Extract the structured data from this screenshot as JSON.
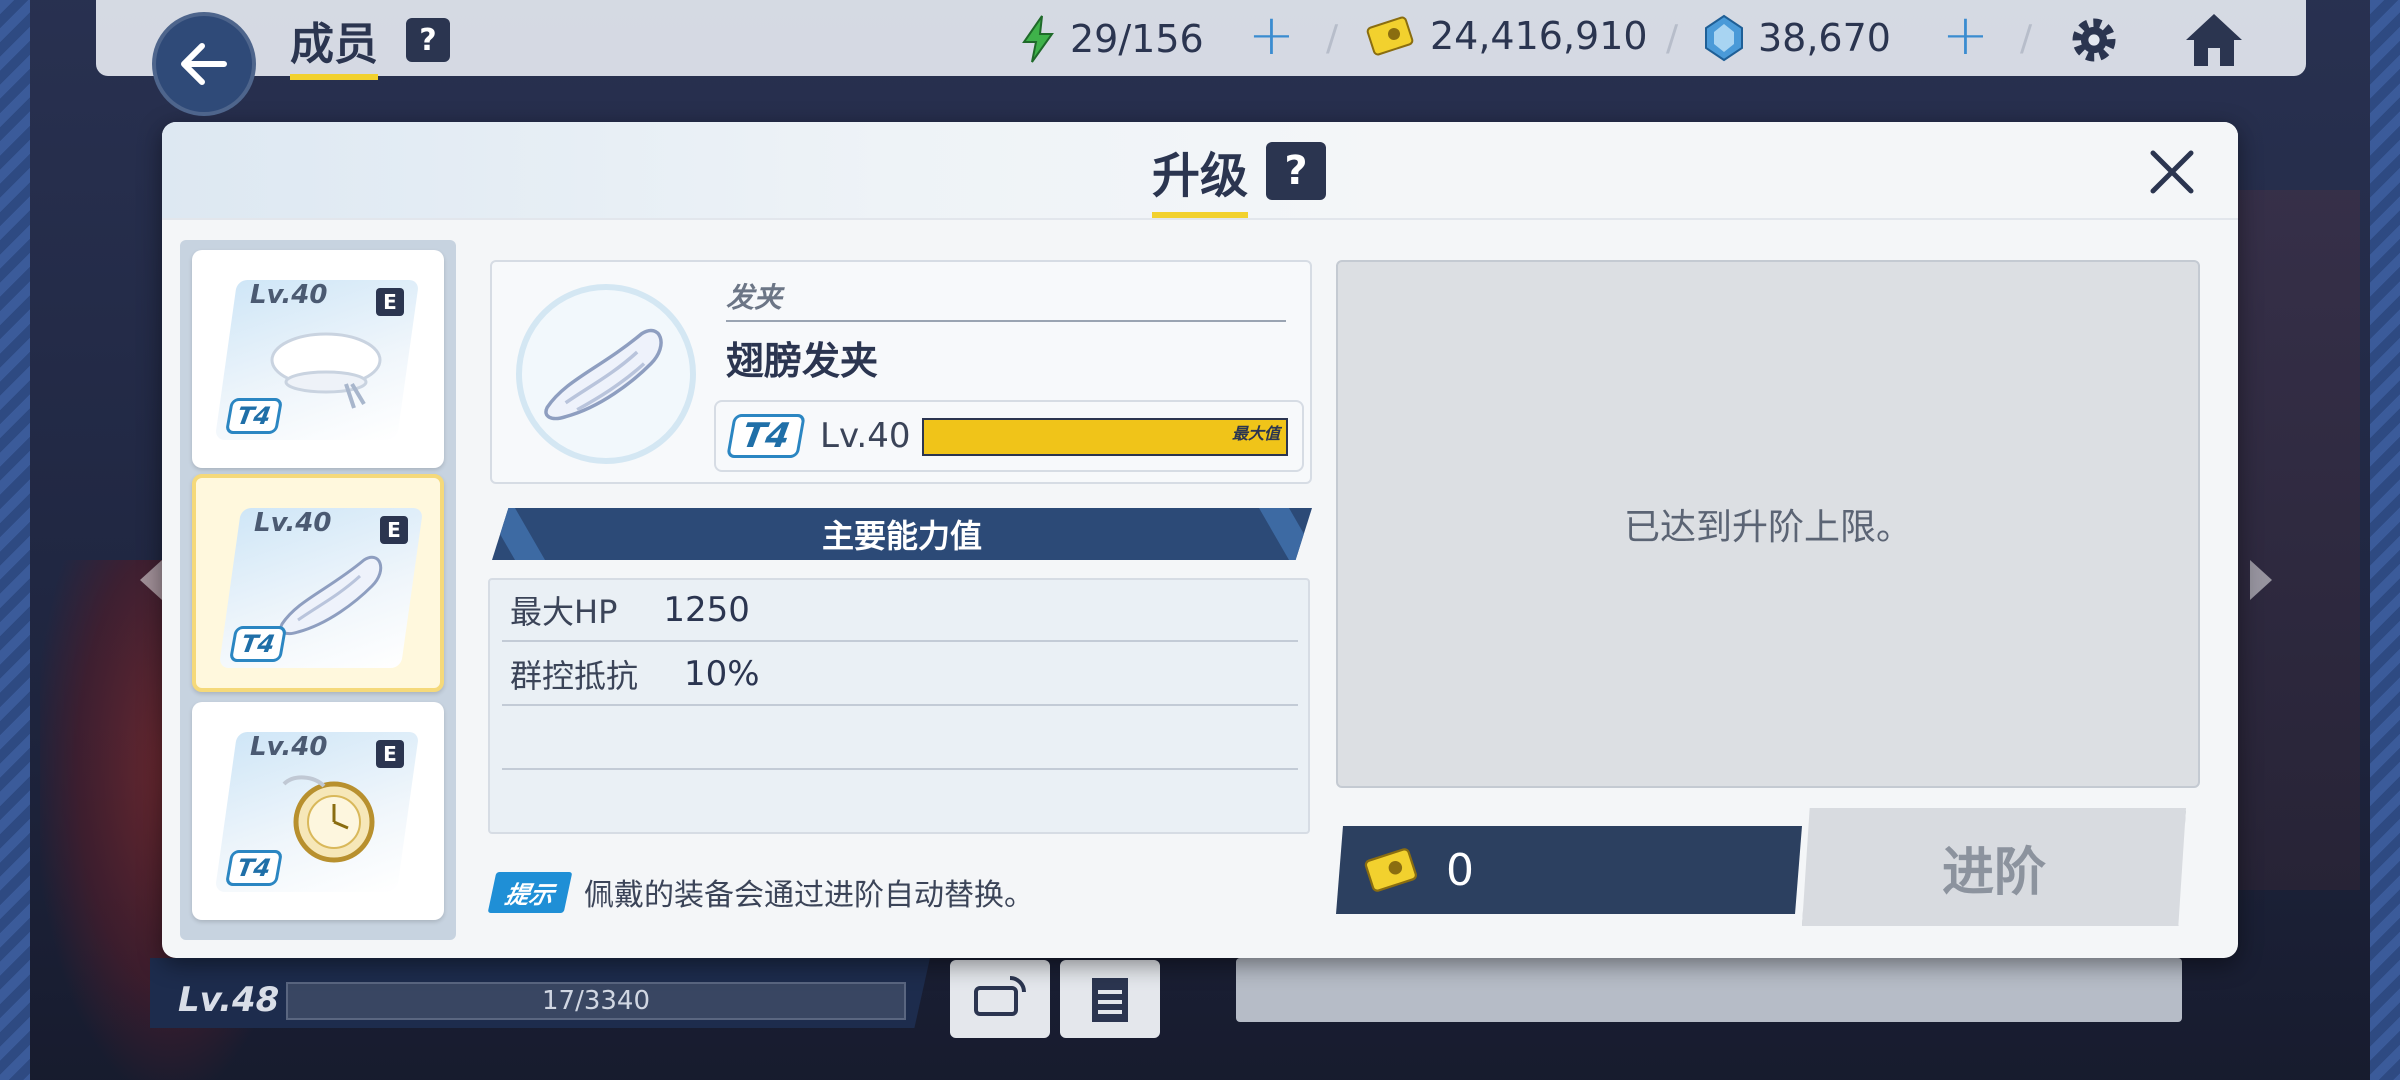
{
  "top_bar": {
    "title": "成员",
    "help_label": "?",
    "stamina": "29/156",
    "credits": "24,416,910",
    "gems": "38,670",
    "separator": "/"
  },
  "dialog": {
    "title": "升级",
    "help_label": "?",
    "equipment_list": [
      {
        "level": "Lv.40",
        "grade": "E",
        "tier": "T4",
        "icon": "beret-hat-icon"
      },
      {
        "level": "Lv.40",
        "grade": "E",
        "tier": "T4",
        "icon": "wing-hairpin-icon",
        "selected": true
      },
      {
        "level": "Lv.40",
        "grade": "E",
        "tier": "T4",
        "icon": "pocket-watch-icon"
      }
    ],
    "item": {
      "category": "发夹",
      "name": "翅膀发夹",
      "tier": "T4",
      "level": "Lv.40",
      "progress": 1.0,
      "progress_label": "最大值"
    },
    "stats_header": "主要能力值",
    "stats": [
      {
        "label": "最大HP",
        "value": "1250"
      },
      {
        "label": "群控抵抗",
        "value": "10%"
      },
      {
        "label": "",
        "value": ""
      }
    ],
    "tip_badge": "提示",
    "tip_text": "佩戴的装备会通过进阶自动替换。",
    "upgrade_message": "已达到升阶上限。",
    "cost": "0",
    "advance_button": "进阶"
  },
  "bottom": {
    "player_level": "Lv.48",
    "exp_text": "17/3340"
  },
  "colors": {
    "accent_yellow": "#f2d12e",
    "navy": "#2b3550",
    "tier_blue": "#2b86c2"
  }
}
